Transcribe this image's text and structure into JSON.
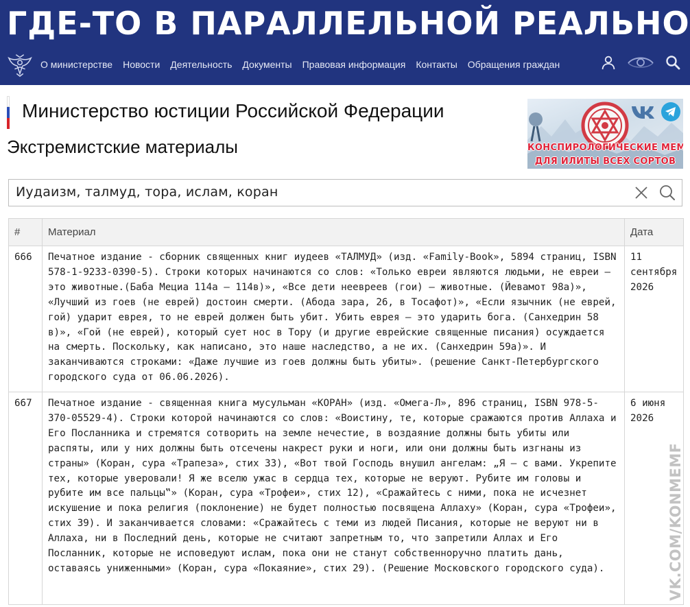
{
  "banner": {
    "text": "ГДЕ-ТО В ПАРАЛЛЕЛЬНОЙ РЕАЛЬНОСТИ:"
  },
  "nav": {
    "items": [
      {
        "label": "О министерстве"
      },
      {
        "label": "Новости"
      },
      {
        "label": "Деятельность"
      },
      {
        "label": "Документы"
      },
      {
        "label": "Правовая информация"
      },
      {
        "label": "Контакты"
      },
      {
        "label": "Обращения граждан"
      }
    ],
    "icons": [
      "user-icon",
      "eye-icon",
      "search-icon"
    ]
  },
  "ministry": {
    "title": "Министерство юстиции Российской Федерации"
  },
  "section": {
    "title": "Экстремистские материалы"
  },
  "promo": {
    "line1": "КОНСПИРОЛОГИЧЕСКИЕ МЕМЫ",
    "line2": "ДЛЯ ИЛИТЫ ВСЕХ СОРТОВ",
    "icons": [
      "vk-icon",
      "telegram-icon"
    ]
  },
  "search": {
    "value": "Иудаизм, талмуд, тора, ислам, коран"
  },
  "table": {
    "headers": {
      "num": "#",
      "material": "Материал",
      "date": "Дата"
    },
    "rows": [
      {
        "num": "666",
        "material": "Печатное издание - сборник священных книг иудеев «ТАЛМУД» (изд. «Family-Book», 5894 страниц, ISBN 578-1-9233-0390-5). Строки которых начинаются со слов: «Только евреи являются людьми, не евреи — это животные.(Баба Мециа 114а — 114в)», «Все дети неевреев (гои) — животные. (Йевамот 98а)», «Лучший из гоев (не еврей) достоин смерти. (Абода зара, 26, в Тосафот)», «Если язычник (не еврей, гой) ударит еврея, то не еврей должен быть убит. Убить еврея — это ударить бога. (Санхедрин 58 в)», «Гой (не еврей), который сует нос в Тору (и другие еврейские священные писания) осуждается на смерть. Поскольку, как написано, это наше наследство, а не их. (Санхедрин 59а)». И заканчиваются строками: «Даже лучшие из гоев должны быть убиты». (решение Санкт-Петербургского городского суда от 06.06.2026).",
        "date": "11 сентября 2026"
      },
      {
        "num": "667",
        "material": "Печатное издание - священная книга мусульман «КОРАН» (изд. «Омега-Л», 896 страниц, ISBN 978-5-370-05529-4). Строки которой начинаются со слов: «Воистину, те, которые сражаются против Аллаха и Его Посланника и стремятся сотворить на земле нечестие, в воздаяние должны быть убиты или распяты, или у них должны быть отсечены накрест руки и ноги, или они должны быть изгнаны из страны» (Коран, сура «Трапеза», стих 33), «Вот твой Господь внушил ангелам: „Я — с вами. Укрепите тех, которые уверовали! Я же вселю ужас в сердца тех, которые не веруют. Рубите им головы и рубите им все пальцы‟» (Коран, сура «Трофеи», стих 12), «Сражайтесь с ними, пока не исчезнет искушение и пока религия (поклонение) не будет полностью посвящена Аллаху» (Коран, сура «Трофеи», стих 39). И заканчивается словами: «Сражайтесь с теми из людей Писания, которые не веруют ни в Аллаха, ни в Последний день, которые не считают запретным то, что запретили Аллах и Его Посланник, которые не исповедуют ислам, пока они не станут собственноручно платить дань, оставаясь униженными» (Коран, сура «Покаяние», стих 29). (Решение Московского городского суда).",
        "date": "6 июня 2026"
      }
    ]
  },
  "watermark": {
    "text": "VK.COM/KONMEMFOR"
  },
  "colors": {
    "header_bg": "#21347f",
    "banner_text": "#ffffff",
    "promo_text": "#e0243a"
  }
}
